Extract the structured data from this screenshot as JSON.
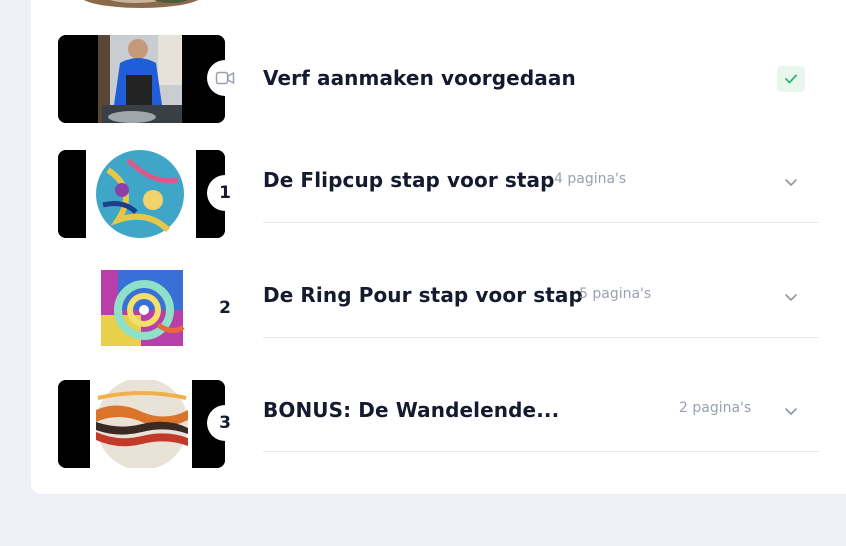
{
  "lessons": [
    {
      "title": "Verf aanmaken voorgedaan",
      "type_icon": "video-icon",
      "completed": true
    },
    {
      "index": "1",
      "title": "De Flipcup stap voor stap",
      "count": "4 pagina's"
    },
    {
      "index": "2",
      "title": "De Ring Pour stap voor stap",
      "count": "5 pagina's"
    },
    {
      "index": "3",
      "title": "BONUS: De Wandelende...",
      "count": "2 pagina's"
    }
  ],
  "colors": {
    "accent_check": "#2bb673",
    "title": "#151a2e",
    "muted": "#9aa1b1"
  }
}
